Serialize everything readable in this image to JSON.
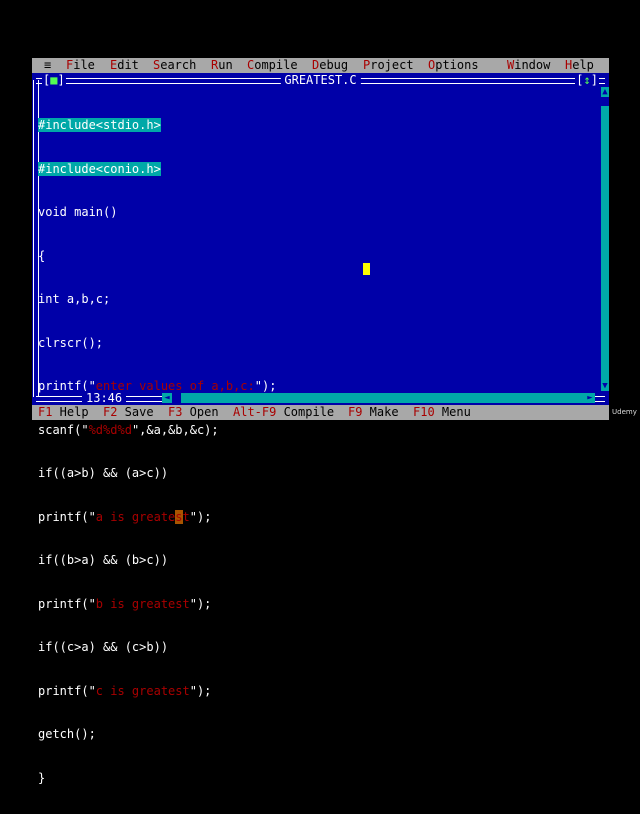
{
  "menubar": {
    "system_icon": "≡",
    "items": [
      {
        "hot": "F",
        "rest": "ile"
      },
      {
        "hot": "E",
        "rest": "dit"
      },
      {
        "hot": "S",
        "rest": "earch"
      },
      {
        "hot": "R",
        "rest": "un"
      },
      {
        "hot": "C",
        "rest": "ompile"
      },
      {
        "hot": "D",
        "rest": "ebug"
      },
      {
        "hot": "P",
        "rest": "roject"
      },
      {
        "hot": "O",
        "rest": "ptions"
      },
      {
        "hot": "W",
        "rest": "indow"
      },
      {
        "hot": "H",
        "rest": "elp"
      }
    ]
  },
  "window": {
    "title": "GREATEST.C",
    "close_glyph": "■",
    "zoom_glyph": "↕",
    "cursor_position": "13:46"
  },
  "code": {
    "lines": [
      "#include<stdio.h>",
      "#include<conio.h>",
      "void main()",
      "{",
      "int a,b,c;",
      "clrscr();",
      "printf(\"enter values of a,b,c:\");",
      "scanf(\"%d%d%d\",&a,&b,&c);",
      "if((a>b) && (a>c))",
      "printf(\"a is greatest\");",
      "if((b>a) && (b>c))",
      "printf(\"b is greatest\");",
      "if((c>a) && (c>b))",
      "printf(\"c is greatest\");",
      "getch();",
      "}"
    ]
  },
  "statusbar": {
    "items": [
      {
        "key": "F1",
        "label": " Help"
      },
      {
        "key": "F2",
        "label": " Save"
      },
      {
        "key": "F3",
        "label": " Open"
      },
      {
        "key": "Alt-F9",
        "label": " Compile"
      },
      {
        "key": "F9",
        "label": " Make"
      },
      {
        "key": "F10",
        "label": " Menu"
      }
    ]
  },
  "watermark": "Udemy",
  "colors": {
    "editor_bg": "#0000a8",
    "menu_bg": "#a8a8a8",
    "hotkey": "#a80000",
    "preprocessor_bg": "#00a8a8",
    "string": "#a80000",
    "cursor": "#fcfc00"
  }
}
